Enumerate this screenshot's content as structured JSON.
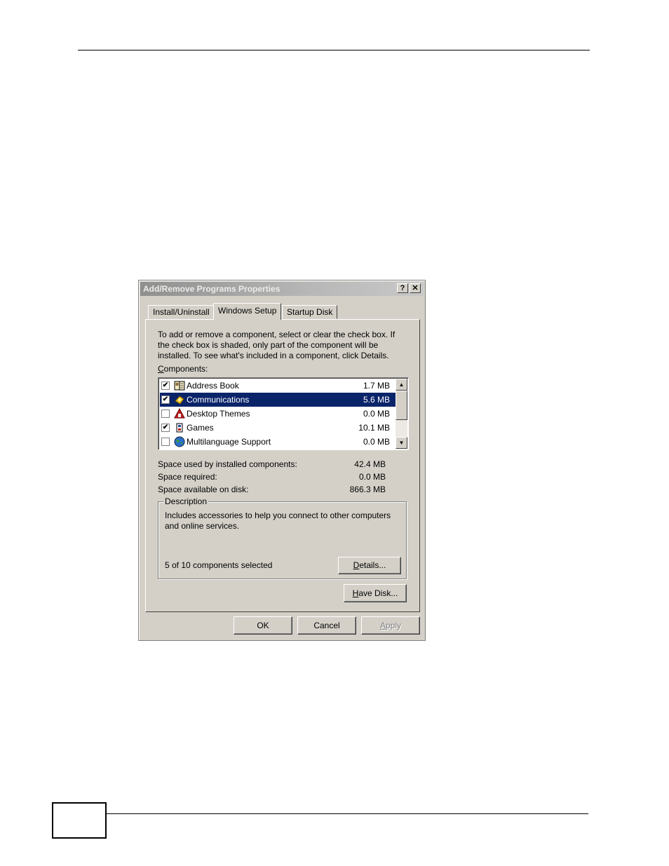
{
  "dialog": {
    "title": "Add/Remove Programs Properties",
    "help_glyph": "?",
    "close_glyph": "✕"
  },
  "tabs": [
    {
      "label": "Install/Uninstall",
      "active": false
    },
    {
      "label": "Windows Setup",
      "active": true
    },
    {
      "label": "Startup Disk",
      "active": false
    }
  ],
  "intro_text": "To add or remove a component, select or clear the check box. If the check box is shaded, only part of the component will be installed. To see what's included in a component, click Details.",
  "components_label": {
    "accel": "C",
    "rest": "omponents:"
  },
  "components": [
    {
      "name": "Address Book",
      "size": "1.7 MB",
      "checked": true,
      "selected": false,
      "icon": "address-book-icon"
    },
    {
      "name": "Communications",
      "size": "5.6 MB",
      "checked": true,
      "selected": true,
      "icon": "communications-icon"
    },
    {
      "name": "Desktop Themes",
      "size": "0.0 MB",
      "checked": false,
      "selected": false,
      "icon": "desktop-themes-icon"
    },
    {
      "name": "Games",
      "size": "10.1 MB",
      "checked": true,
      "selected": false,
      "icon": "games-icon"
    },
    {
      "name": "Multilanguage Support",
      "size": "0.0 MB",
      "checked": false,
      "selected": false,
      "icon": "globe-icon"
    }
  ],
  "space": {
    "used_label": "Space used by installed components:",
    "used_value": "42.4 MB",
    "required_label": "Space required:",
    "required_value": "0.0 MB",
    "available_label": "Space available on disk:",
    "available_value": "866.3 MB"
  },
  "description": {
    "legend": "Description",
    "text": "Includes accessories to help you connect to other computers and online services.",
    "selected_count": "5 of 10 components selected"
  },
  "buttons": {
    "details": {
      "accel": "D",
      "rest": "etails..."
    },
    "have_disk": {
      "accel": "H",
      "rest": "ave Disk..."
    },
    "ok": "OK",
    "cancel": "Cancel",
    "apply": {
      "accel": "A",
      "rest": "pply"
    }
  }
}
